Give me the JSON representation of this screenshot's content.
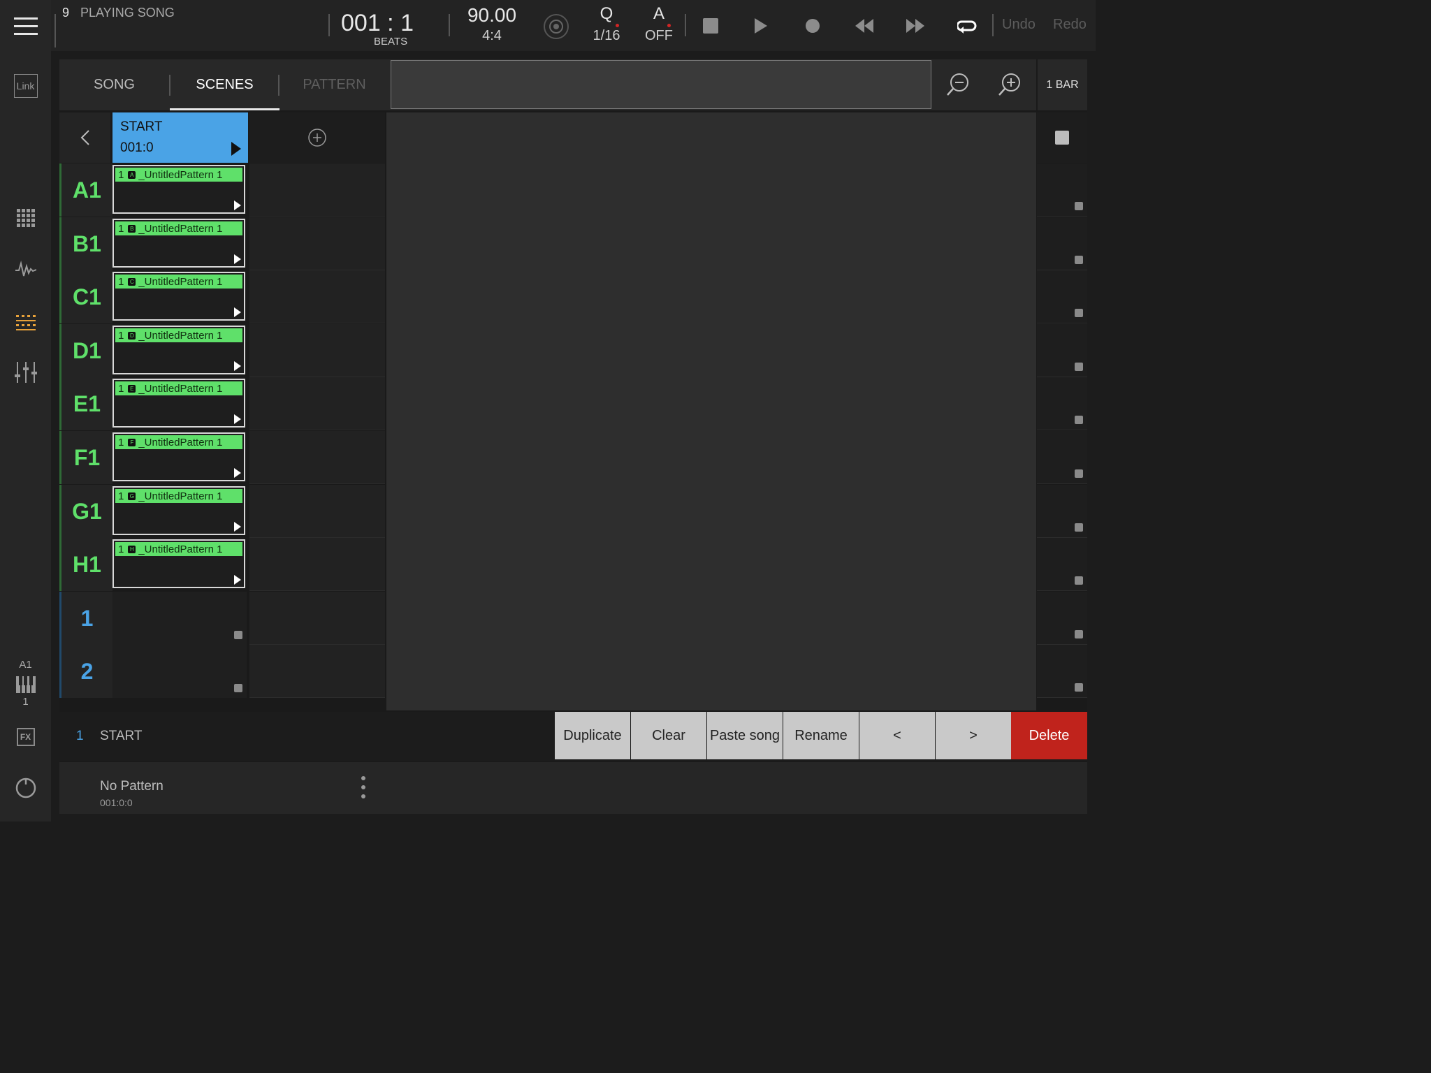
{
  "topbar": {
    "song_number": "9",
    "song_status": "PLAYING SONG",
    "position": "001 : 1",
    "position_unit": "BEATS",
    "tempo": "90.00",
    "time_signature": "4:4",
    "quantize_label": "Q",
    "quantize_value": "1/16",
    "automation_label": "A",
    "automation_value": "OFF",
    "undo_label": "Undo",
    "redo_label": "Redo"
  },
  "sidebar": {
    "link_label": "Link",
    "track_label": "A1",
    "track_number": "1",
    "fx_label": "FX"
  },
  "tabs": [
    {
      "label": "SONG",
      "state": "inactive"
    },
    {
      "label": "SCENES",
      "state": "active"
    },
    {
      "label": "PATTERN",
      "state": "disabled"
    }
  ],
  "zoom_label": "1 BAR",
  "scene": {
    "name": "START",
    "position": "001:0"
  },
  "rows": [
    {
      "label": "A1",
      "clip": "1",
      "badge": "A",
      "pattern": "_UntitledPattern 1"
    },
    {
      "label": "B1",
      "clip": "1",
      "badge": "B",
      "pattern": "_UntitledPattern 1"
    },
    {
      "label": "C1",
      "clip": "1",
      "badge": "C",
      "pattern": "_UntitledPattern 1"
    },
    {
      "label": "D1",
      "clip": "1",
      "badge": "D",
      "pattern": "_UntitledPattern 1"
    },
    {
      "label": "E1",
      "clip": "1",
      "badge": "E",
      "pattern": "_UntitledPattern 1"
    },
    {
      "label": "F1",
      "clip": "1",
      "badge": "F",
      "pattern": "_UntitledPattern 1"
    },
    {
      "label": "G1",
      "clip": "1",
      "badge": "G",
      "pattern": "_UntitledPattern 1"
    },
    {
      "label": "H1",
      "clip": "1",
      "badge": "H",
      "pattern": "_UntitledPattern 1"
    },
    {
      "label": "1"
    },
    {
      "label": "2"
    }
  ],
  "footer": {
    "scene_index": "1",
    "scene_name": "START",
    "buttons": [
      "Duplicate",
      "Clear",
      "Paste song",
      "Rename",
      "<",
      ">",
      "Delete"
    ],
    "pattern_name": "No Pattern",
    "pattern_position": "001:0:0"
  },
  "colors": {
    "accent_blue": "#4aa3e6",
    "clip_green": "#5fe06a",
    "delete_red": "#c0231c",
    "record_dot": "#d22525"
  }
}
